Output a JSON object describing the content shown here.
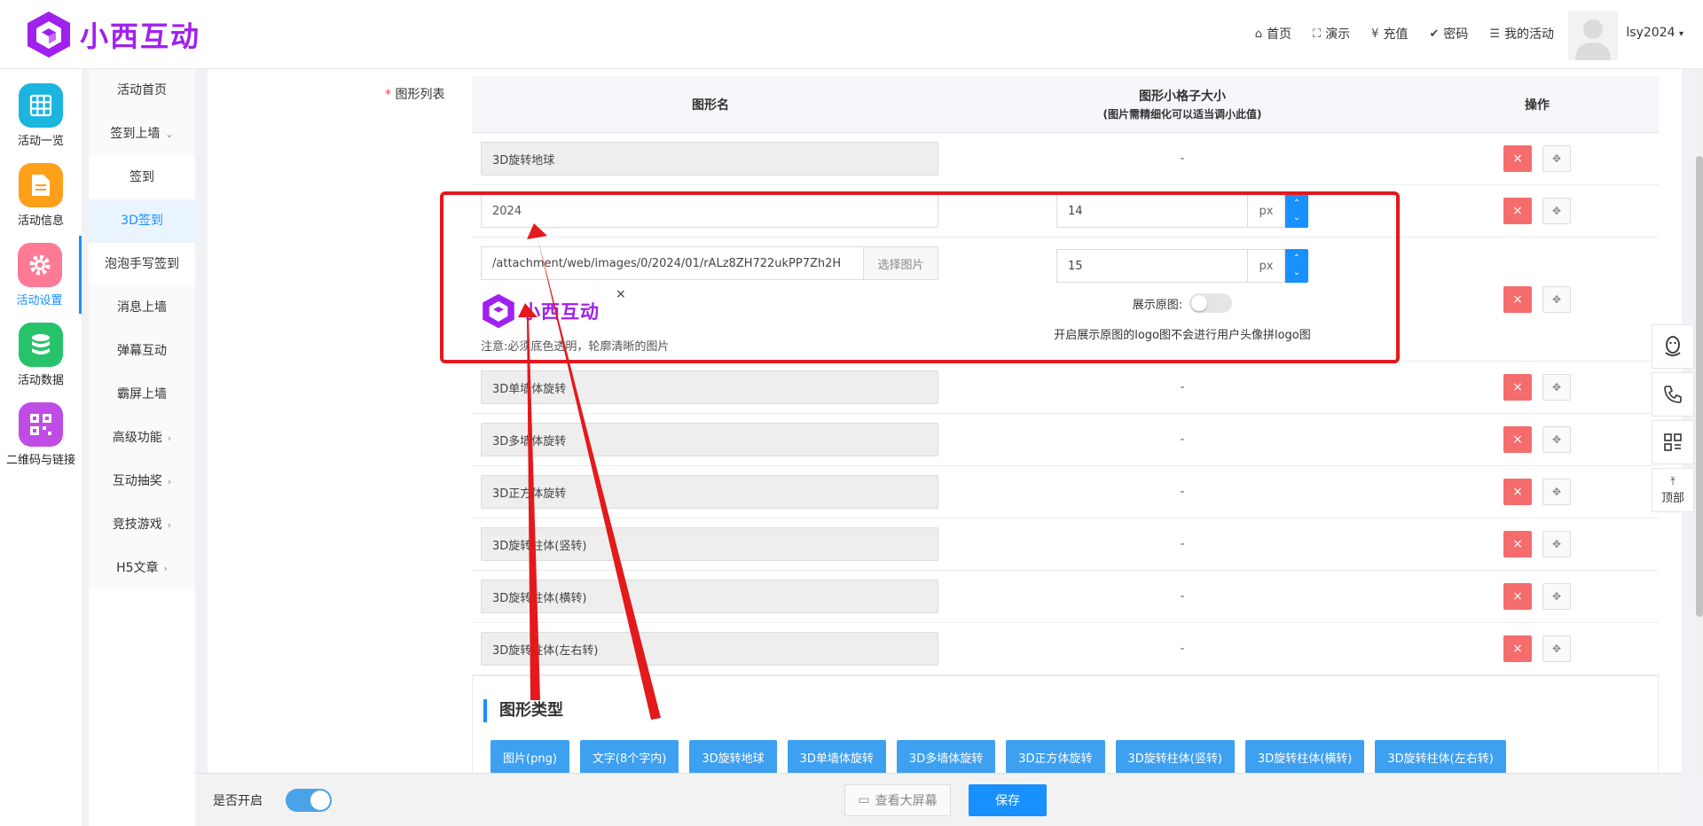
{
  "brand": {
    "name": "小西互动",
    "color": "#a020f0"
  },
  "nav": {
    "home": "首页",
    "demo": "演示",
    "recharge": "充值",
    "password": "密码",
    "my_activities": "我的活动",
    "user": "lsy2024"
  },
  "rail": [
    {
      "label": "活动一览",
      "icon": "grid-icon",
      "color": "#1cb5e0"
    },
    {
      "label": "活动信息",
      "icon": "document-icon",
      "color": "#ff9f1a"
    },
    {
      "label": "活动设置",
      "icon": "gear-icon",
      "color": "#ff7a95"
    },
    {
      "label": "活动数据",
      "icon": "database-icon",
      "color": "#27c36a"
    },
    {
      "label": "二维码与链接",
      "icon": "qrcode-icon",
      "color": "#c04ce6"
    }
  ],
  "submenu": {
    "home": "活动首页",
    "signin_wall": "签到上墙",
    "signin": "签到",
    "signin_3d": "3D签到",
    "bubble": "泡泡手写签到",
    "message_wall": "消息上墙",
    "danmaku": "弹幕互动",
    "bully_screen": "霸屏上墙",
    "advanced": "高级功能",
    "lottery": "互动抽奖",
    "games": "竞技游戏",
    "h5": "H5文章"
  },
  "list": {
    "label": "图形列表",
    "required": "*",
    "headers": {
      "name": "图形名",
      "size": "图形小格子大小",
      "size_note": "(图片需精细化可以适当调小此值)",
      "action": "操作"
    },
    "dash": "-",
    "unit": "px",
    "rows": [
      {
        "name": "3D旋转地球"
      },
      {
        "name": "2024",
        "size": "14"
      },
      {
        "path": "/attachment/web/images/0/2024/01/rALz8ZH722ukPP7Zh2H",
        "size": "15"
      },
      {
        "name": "3D单墙体旋转"
      },
      {
        "name": "3D多墙体旋转"
      },
      {
        "name": "3D正方体旋转"
      },
      {
        "name": "3D旋转柱体(竖转)"
      },
      {
        "name": "3D旋转柱体(横转)"
      },
      {
        "name": "3D旋转柱体(左右转)"
      }
    ],
    "select_image": "选择图片",
    "preview_close": "×",
    "note": "注意:必须底色透明，轮廓清晰的图片",
    "show_original": "展示原图:",
    "show_original_tip": "开启展示原图的logo图不会进行用户头像拼logo图",
    "delete": "×",
    "move": "✥"
  },
  "types": {
    "title": "图形类型",
    "buttons": [
      "图片(png)",
      "文字(8个字内)",
      "3D旋转地球",
      "3D单墙体旋转",
      "3D多墙体旋转",
      "3D正方体旋转",
      "3D旋转柱体(竖转)",
      "3D旋转柱体(横转)",
      "3D旋转柱体(左右转)"
    ]
  },
  "footer": {
    "enable": "是否开启",
    "preview": "查看大屏幕",
    "save": "保存"
  },
  "float": {
    "top": "顶部"
  },
  "colors": {
    "accent": "#1890ff",
    "danger": "#f56c6c",
    "highlight": "#e3191c"
  }
}
